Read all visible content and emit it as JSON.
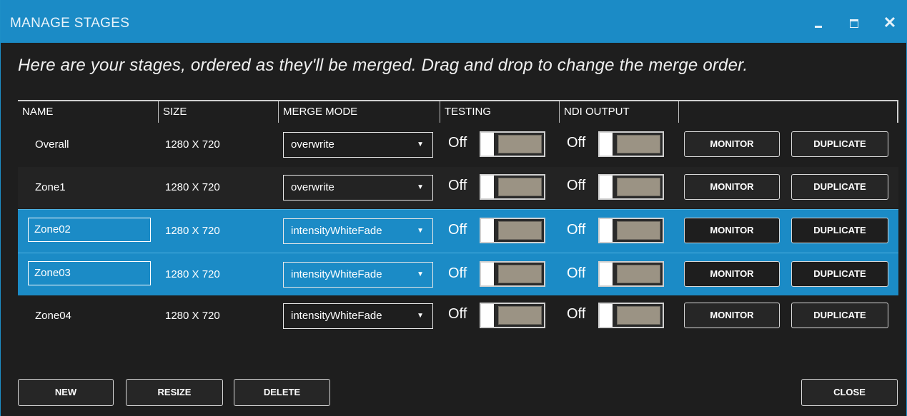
{
  "window": {
    "title": "MANAGE STAGES"
  },
  "instructions": "Here are your stages, ordered as they'll be merged. Drag and drop to change the merge order.",
  "columns": {
    "name": "NAME",
    "size": "SIZE",
    "merge_mode": "MERGE MODE",
    "testing": "TESTING",
    "ndi_output": "NDI OUTPUT"
  },
  "rows": [
    {
      "name": "Overall",
      "size": "1280 X 720",
      "merge_mode": "overwrite",
      "testing": "Off",
      "ndi": "Off",
      "monitor": "MONITOR",
      "duplicate": "DUPLICATE"
    },
    {
      "name": "Zone1",
      "size": "1280 X 720",
      "merge_mode": "overwrite",
      "testing": "Off",
      "ndi": "Off",
      "monitor": "MONITOR",
      "duplicate": "DUPLICATE"
    },
    {
      "name": "Zone02",
      "size": "1280 X 720",
      "merge_mode": "intensityWhiteFade",
      "testing": "Off",
      "ndi": "Off",
      "monitor": "MONITOR",
      "duplicate": "DUPLICATE"
    },
    {
      "name": "Zone03",
      "size": "1280 X 720",
      "merge_mode": "intensityWhiteFade",
      "testing": "Off",
      "ndi": "Off",
      "monitor": "MONITOR",
      "duplicate": "DUPLICATE"
    },
    {
      "name": "Zone04",
      "size": "1280 X 720",
      "merge_mode": "intensityWhiteFade",
      "testing": "Off",
      "ndi": "Off",
      "monitor": "MONITOR",
      "duplicate": "DUPLICATE"
    }
  ],
  "footer": {
    "new": "NEW",
    "resize": "RESIZE",
    "delete": "DELETE",
    "close": "CLOSE"
  },
  "colors": {
    "accent": "#1b8bc6",
    "background": "#1e1e1e"
  }
}
